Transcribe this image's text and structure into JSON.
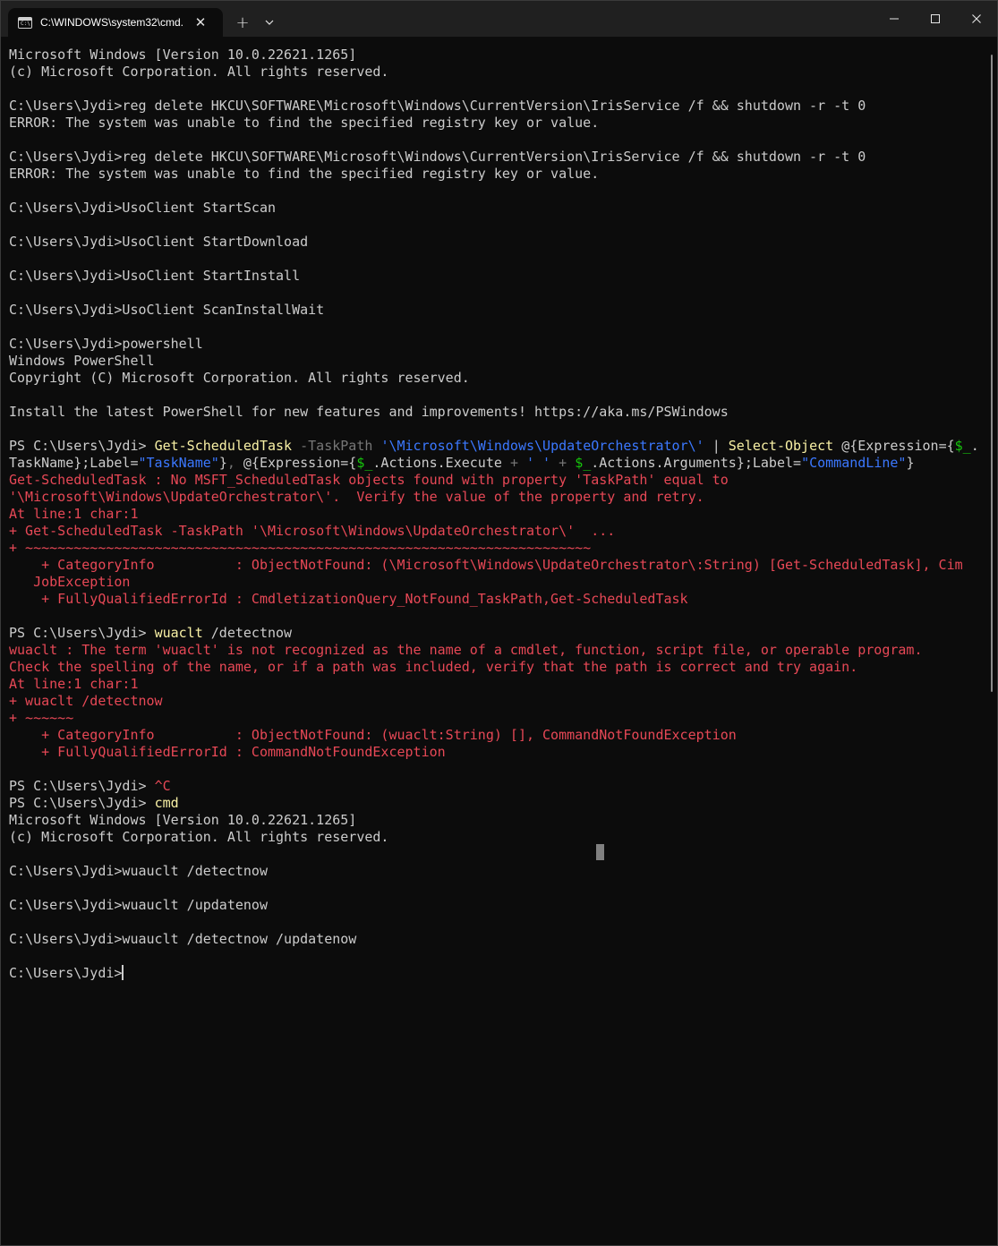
{
  "window": {
    "tab_title": "C:\\WINDOWS\\system32\\cmd.",
    "tab_icon_text": "C:\\",
    "tab_close": "✕",
    "new_tab": "+",
    "dropdown": "⌄"
  },
  "colors": {
    "background": "#0c0c0c",
    "titlebar": "#202020",
    "text": "#cccccc",
    "error": "#e74856",
    "command": "#f9f1a5",
    "parameter": "#767676",
    "string": "#3b78ff",
    "variable": "#16c60c"
  },
  "terminal": {
    "lines": [
      [
        {
          "t": "Microsoft Windows [Version 10.0.22621.1265]"
        }
      ],
      [
        {
          "t": "(c) Microsoft Corporation. All rights reserved."
        }
      ],
      [],
      [
        {
          "t": "C:\\Users\\Jydi>reg delete HKCU\\SOFTWARE\\Microsoft\\Windows\\CurrentVersion\\IrisService /f && shutdown -r -t 0"
        }
      ],
      [
        {
          "t": "ERROR: The system was unable to find the specified registry key or value."
        }
      ],
      [],
      [
        {
          "t": "C:\\Users\\Jydi>reg delete HKCU\\SOFTWARE\\Microsoft\\Windows\\CurrentVersion\\IrisService /f && shutdown -r -t 0"
        }
      ],
      [
        {
          "t": "ERROR: The system was unable to find the specified registry key or value."
        }
      ],
      [],
      [
        {
          "t": "C:\\Users\\Jydi>UsoClient StartScan"
        }
      ],
      [],
      [
        {
          "t": "C:\\Users\\Jydi>UsoClient StartDownload"
        }
      ],
      [],
      [
        {
          "t": "C:\\Users\\Jydi>UsoClient StartInstall"
        }
      ],
      [],
      [
        {
          "t": "C:\\Users\\Jydi>UsoClient ScanInstallWait"
        }
      ],
      [],
      [
        {
          "t": "C:\\Users\\Jydi>powershell"
        }
      ],
      [
        {
          "t": "Windows PowerShell"
        }
      ],
      [
        {
          "t": "Copyright (C) Microsoft Corporation. All rights reserved."
        }
      ],
      [],
      [
        {
          "t": "Install the latest PowerShell for new features and improvements! https://aka.ms/PSWindows"
        }
      ],
      [],
      [
        {
          "t": "PS C:\\Users\\Jydi> "
        },
        {
          "t": "Get-ScheduledTask",
          "c": "cmd"
        },
        {
          "t": " -TaskPath ",
          "c": "prm"
        },
        {
          "t": "'\\Microsoft\\Windows\\UpdateOrchestrator\\'",
          "c": "str"
        },
        {
          "t": " | "
        },
        {
          "t": "Select-Object",
          "c": "cmd"
        },
        {
          "t": " @{Expression={"
        },
        {
          "t": "$_",
          "c": "var"
        },
        {
          "t": "."
        }
      ],
      [
        {
          "t": "TaskName};Label="
        },
        {
          "t": "\"TaskName\"",
          "c": "str"
        },
        {
          "t": "}"
        },
        {
          "t": ",",
          "c": "prm"
        },
        {
          "t": " @{Expression={"
        },
        {
          "t": "$_",
          "c": "var"
        },
        {
          "t": ".Actions.Execute "
        },
        {
          "t": "+",
          "c": "prm"
        },
        {
          "t": " "
        },
        {
          "t": "' '",
          "c": "str"
        },
        {
          "t": " "
        },
        {
          "t": "+",
          "c": "prm"
        },
        {
          "t": " "
        },
        {
          "t": "$_",
          "c": "var"
        },
        {
          "t": ".Actions.Arguments};Label="
        },
        {
          "t": "\"CommandLine\"",
          "c": "str"
        },
        {
          "t": "}"
        }
      ],
      [
        {
          "t": "Get-ScheduledTask : No MSFT_ScheduledTask objects found with property 'TaskPath' equal to",
          "c": "err"
        }
      ],
      [
        {
          "t": "'\\Microsoft\\Windows\\UpdateOrchestrator\\'.  Verify the value of the property and retry.",
          "c": "err"
        }
      ],
      [
        {
          "t": "At line:1 char:1",
          "c": "err"
        }
      ],
      [
        {
          "t": "+ Get-ScheduledTask -TaskPath '\\Microsoft\\Windows\\UpdateOrchestrator\\'  ...",
          "c": "err"
        }
      ],
      [
        {
          "t": "+ ~~~~~~~~~~~~~~~~~~~~~~~~~~~~~~~~~~~~~~~~~~~~~~~~~~~~~~~~~~~~~~~~~~~~~~",
          "c": "err"
        }
      ],
      [
        {
          "t": "    + CategoryInfo          : ObjectNotFound: (\\Microsoft\\Windows\\UpdateOrchestrator\\:String) [Get-ScheduledTask], Cim",
          "c": "err"
        }
      ],
      [
        {
          "t": "   JobException",
          "c": "err"
        }
      ],
      [
        {
          "t": "    + FullyQualifiedErrorId : CmdletizationQuery_NotFound_TaskPath,Get-ScheduledTask",
          "c": "err"
        }
      ],
      [],
      [
        {
          "t": "PS C:\\Users\\Jydi> "
        },
        {
          "t": "wuaclt",
          "c": "cmd"
        },
        {
          "t": " /detectnow"
        }
      ],
      [
        {
          "t": "wuaclt : The term 'wuaclt' is not recognized as the name of a cmdlet, function, script file, or operable program.",
          "c": "err"
        }
      ],
      [
        {
          "t": "Check the spelling of the name, or if a path was included, verify that the path is correct and try again.",
          "c": "err"
        }
      ],
      [
        {
          "t": "At line:1 char:1",
          "c": "err"
        }
      ],
      [
        {
          "t": "+ wuaclt /detectnow",
          "c": "err"
        }
      ],
      [
        {
          "t": "+ ~~~~~~",
          "c": "err"
        }
      ],
      [
        {
          "t": "    + CategoryInfo          : ObjectNotFound: (wuaclt:String) [], CommandNotFoundException",
          "c": "err"
        }
      ],
      [
        {
          "t": "    + FullyQualifiedErrorId : CommandNotFoundException",
          "c": "err"
        }
      ],
      [],
      [
        {
          "t": "PS C:\\Users\\Jydi> "
        },
        {
          "t": "^C",
          "c": "err"
        }
      ],
      [
        {
          "t": "PS C:\\Users\\Jydi> "
        },
        {
          "t": "cmd",
          "c": "cmd"
        }
      ],
      [
        {
          "t": "Microsoft Windows [Version 10.0.22621.1265]"
        }
      ],
      [
        {
          "t": "(c) Microsoft Corporation. All rights reserved."
        }
      ],
      [],
      [
        {
          "t": "C:\\Users\\Jydi>wuauclt /detectnow"
        }
      ],
      [],
      [
        {
          "t": "C:\\Users\\Jydi>wuauclt /updatenow"
        }
      ],
      [],
      [
        {
          "t": "C:\\Users\\Jydi>wuauclt /detectnow /updatenow"
        }
      ],
      [],
      [
        {
          "t": "C:\\Users\\Jydi>"
        }
      ]
    ]
  }
}
